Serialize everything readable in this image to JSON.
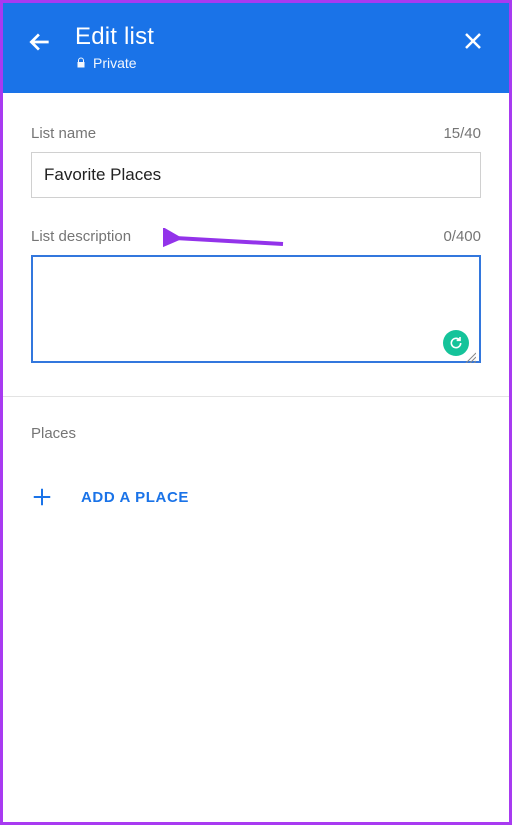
{
  "header": {
    "title": "Edit list",
    "privacy": "Private"
  },
  "fields": {
    "name": {
      "label": "List name",
      "value": "Favorite Places",
      "counter": "15/40"
    },
    "description": {
      "label": "List description",
      "value": "",
      "counter": "0/400"
    }
  },
  "places": {
    "heading": "Places",
    "add_label": "ADD A PLACE"
  },
  "colors": {
    "accent": "#1a73e8",
    "annotation": "#9333ea"
  }
}
